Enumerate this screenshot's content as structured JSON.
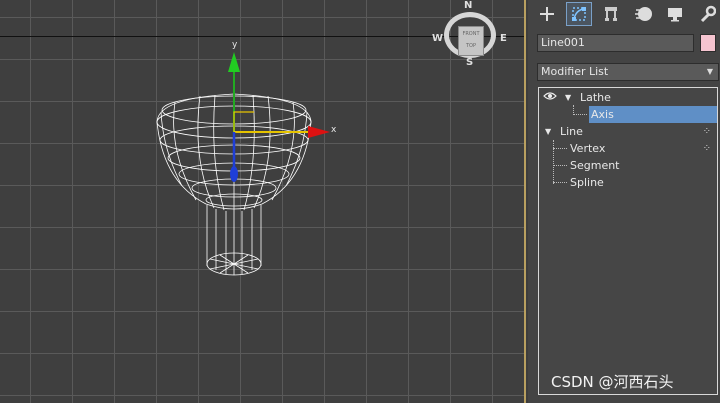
{
  "viewport": {
    "viewcube": {
      "north": "N",
      "west": "W",
      "east": "E",
      "south": "S",
      "face_label": "TOP",
      "face_small": "FRONT"
    },
    "gizmo": {
      "x_label": "x",
      "y_label": "y"
    }
  },
  "panel": {
    "toolbar": {
      "icons": [
        "create-icon",
        "modify-icon",
        "hierarchy-icon",
        "motion-icon",
        "display-icon",
        "utilities-icon"
      ]
    },
    "object_name": "Line001",
    "object_color": "#f5c4d0",
    "modifier_list_label": "Modifier List",
    "stack": {
      "items": [
        {
          "label": "Lathe"
        },
        {
          "label": "Axis"
        },
        {
          "label": "Line"
        },
        {
          "label": "Vertex"
        },
        {
          "label": "Segment"
        },
        {
          "label": "Spline"
        }
      ]
    }
  },
  "watermark": "CSDN @河西石头",
  "colors": {
    "selection": "#5f8fc6",
    "grid": "#5a5a5a",
    "viewport_bg": "#3f3f3f"
  }
}
